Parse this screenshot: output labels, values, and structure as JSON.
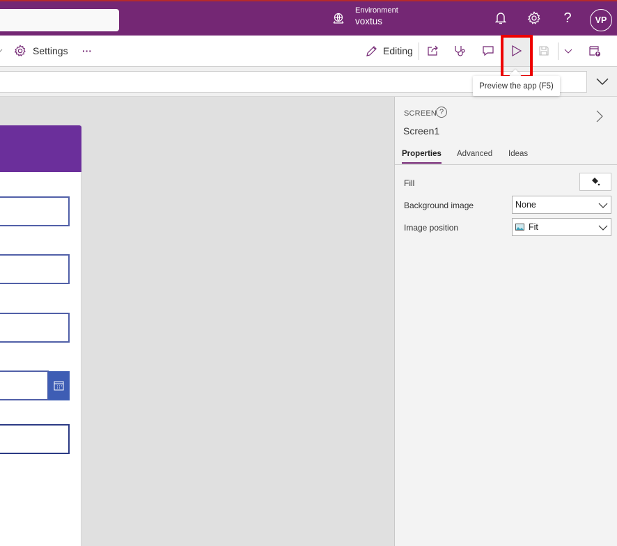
{
  "topbar": {
    "search_placeholder": "",
    "environment_label": "Environment",
    "environment_name": "voxtus",
    "avatar_initials": "VP",
    "help_glyph": "?"
  },
  "commandbar": {
    "settings_label": "Settings",
    "more_label": "···",
    "editing_label": "Editing",
    "icons": [
      "chevron-down-icon",
      "gear-icon",
      "more-icon",
      "pencil-icon",
      "share-icon",
      "stethoscope-icon",
      "comment-icon",
      "play-icon",
      "save-icon",
      "chevron-down-icon",
      "publish-icon"
    ]
  },
  "tooltip": {
    "text": "Preview the app (F5)"
  },
  "formula_bar": {
    "value": ""
  },
  "canvas": {
    "field_count": 5
  },
  "properties_pane": {
    "section_label": "SCREEN",
    "help_glyph": "?",
    "screen_name": "Screen1",
    "tabs": [
      {
        "label": "Properties",
        "active": true
      },
      {
        "label": "Advanced",
        "active": false
      },
      {
        "label": "Ideas",
        "active": false
      }
    ],
    "properties": [
      {
        "label": "Fill",
        "type": "color"
      },
      {
        "label": "Background image",
        "type": "dropdown",
        "value": "None"
      },
      {
        "label": "Image position",
        "type": "dropdown",
        "value": "Fit"
      }
    ]
  },
  "colors": {
    "brand": "#742774",
    "app_header": "#6b2f9b",
    "field_border": "#5160a8",
    "date_button": "#3e5db4",
    "highlight": "#ee0000"
  }
}
